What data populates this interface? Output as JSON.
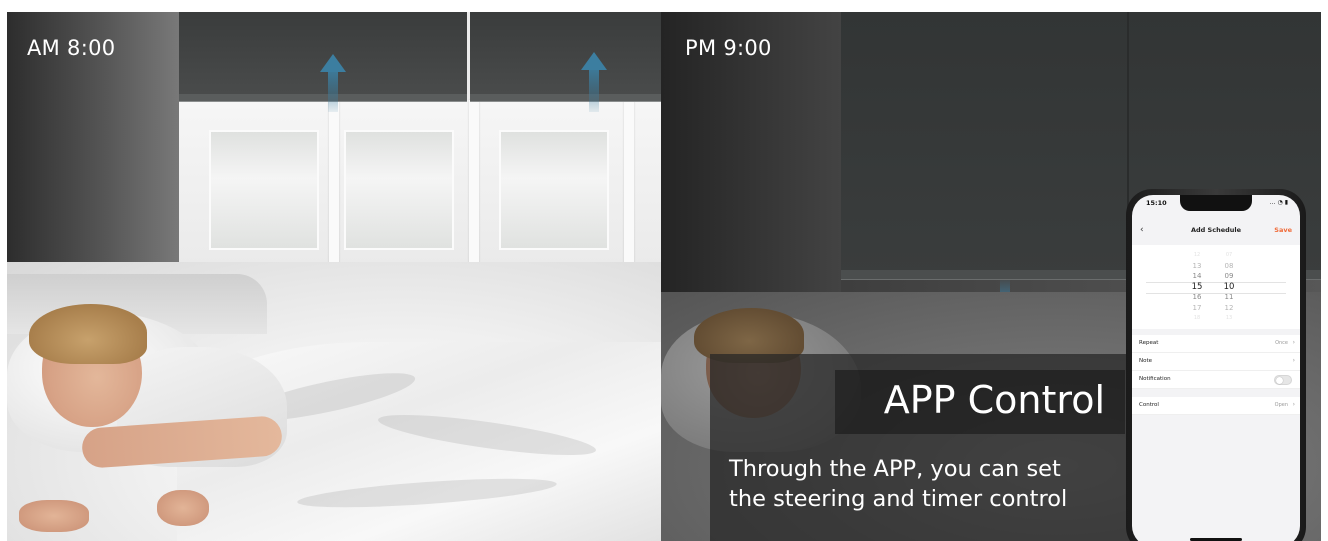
{
  "morning": {
    "time_label": "AM 8:00"
  },
  "night": {
    "time_label": "PM 9:00"
  },
  "promo": {
    "title": "APP Control",
    "description_line1": "Through the APP, you can set",
    "description_line2": "the steering and timer control"
  },
  "phone": {
    "status_time": "15:10",
    "status_icons": "… ◔ ▮",
    "screen_title": "Add Schedule",
    "save_label": "Save",
    "back_icon": "chevron-left-icon",
    "picker": {
      "hours": [
        "12",
        "13",
        "14",
        "15",
        "16",
        "17",
        "18"
      ],
      "minutes": [
        "07",
        "08",
        "09",
        "10",
        "11",
        "12",
        "13"
      ],
      "selected_hour": "15",
      "selected_minute": "10"
    },
    "settings": {
      "repeat_label": "Repeat",
      "repeat_value": "Once",
      "note_label": "Note",
      "notification_label": "Notification",
      "notification_on": false,
      "control_label": "Control",
      "control_value": "Open"
    }
  },
  "colors": {
    "accent_save": "#f06a38",
    "arrow": "#3c7ea0",
    "overlay": "#262626"
  }
}
